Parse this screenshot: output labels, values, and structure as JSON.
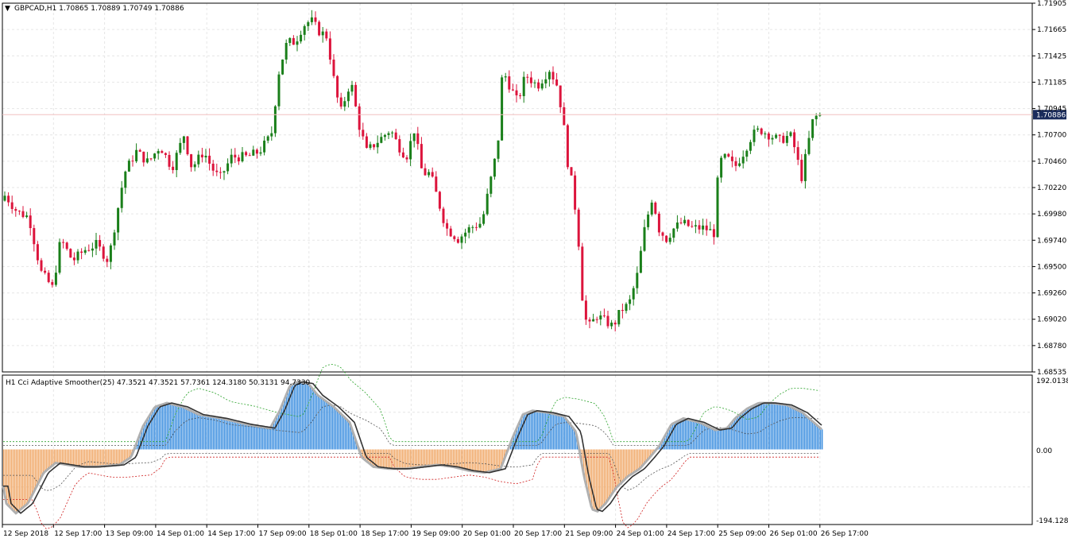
{
  "window": {
    "title": "GBPCAD,H1  1.70865 1.70889 1.70749 1.70886"
  },
  "indicator": {
    "title": "H1 Cci Adaptive Smoother(25) 47.3521 47.3521 57.7361 124.3180 50.3131 94.7330",
    "scale_labels": [
      "192.0138",
      "0.00",
      "-194.1283"
    ]
  },
  "price_axis": {
    "labels": [
      "1.71905",
      "1.71665",
      "1.71425",
      "1.71185",
      "1.70945",
      "1.70700",
      "1.70460",
      "1.70220",
      "1.69980",
      "1.69740",
      "1.69500",
      "1.69260",
      "1.69020",
      "1.68780",
      "1.68535"
    ],
    "current_price": "1.70886"
  },
  "time_axis": {
    "labels": [
      "12 Sep 2018",
      "12 Sep 17:00",
      "13 Sep 09:00",
      "14 Sep 01:00",
      "14 Sep 17:00",
      "17 Sep 09:00",
      "18 Sep 01:00",
      "18 Sep 17:00",
      "19 Sep 09:00",
      "20 Sep 01:00",
      "20 Sep 17:00",
      "21 Sep 09:00",
      "24 Sep 01:00",
      "24 Sep 17:00",
      "25 Sep 09:00",
      "26 Sep 01:00",
      "26 Sep 17:00"
    ]
  },
  "colors": {
    "bull": "#1a7f1a",
    "bear": "#dc143c",
    "hist_pos": "#3d8fe0",
    "hist_neg": "#f0a868",
    "line_main": "#333333",
    "line_shadow": "#b0b0b0",
    "grid": "#e6e6e6",
    "current_price_bg": "#1a2c5c"
  },
  "chart_data": {
    "type": "candlestick",
    "symbol": "GBPCAD",
    "timeframe": "H1",
    "ylim": [
      1.68535,
      1.71905
    ],
    "price_path": [
      [
        0,
        1.7005
      ],
      [
        10,
        1.7015
      ],
      [
        25,
        1.7
      ],
      [
        40,
        1.6995
      ],
      [
        55,
        1.6945
      ],
      [
        70,
        1.693
      ],
      [
        80,
        1.6975
      ],
      [
        95,
        1.6955
      ],
      [
        110,
        1.6965
      ],
      [
        125,
        1.697
      ],
      [
        140,
        1.6955
      ],
      [
        150,
        1.6995
      ],
      [
        160,
        1.7035
      ],
      [
        175,
        1.7055
      ],
      [
        190,
        1.7045
      ],
      [
        205,
        1.706
      ],
      [
        220,
        1.704
      ],
      [
        235,
        1.707
      ],
      [
        245,
        1.704
      ],
      [
        260,
        1.7055
      ],
      [
        270,
        1.704
      ],
      [
        280,
        1.703
      ],
      [
        295,
        1.705
      ],
      [
        315,
        1.705
      ],
      [
        330,
        1.7055
      ],
      [
        345,
        1.707
      ],
      [
        355,
        1.713
      ],
      [
        365,
        1.7155
      ],
      [
        375,
        1.7155
      ],
      [
        385,
        1.717
      ],
      [
        395,
        1.7175
      ],
      [
        405,
        1.7165
      ],
      [
        415,
        1.716
      ],
      [
        425,
        1.7115
      ],
      [
        432,
        1.709
      ],
      [
        445,
        1.712
      ],
      [
        455,
        1.708
      ],
      [
        465,
        1.7055
      ],
      [
        480,
        1.7065
      ],
      [
        495,
        1.7075
      ],
      [
        505,
        1.706
      ],
      [
        515,
        1.705
      ],
      [
        525,
        1.7075
      ],
      [
        535,
        1.7035
      ],
      [
        545,
        1.7035
      ],
      [
        555,
        1.701
      ],
      [
        565,
        1.6985
      ],
      [
        580,
        1.6975
      ],
      [
        595,
        1.6985
      ],
      [
        610,
        1.699
      ],
      [
        620,
        1.7025
      ],
      [
        630,
        1.706
      ],
      [
        636,
        1.713
      ],
      [
        645,
        1.7115
      ],
      [
        655,
        1.71
      ],
      [
        665,
        1.7125
      ],
      [
        680,
        1.7115
      ],
      [
        695,
        1.713
      ],
      [
        705,
        1.7115
      ],
      [
        712,
        1.7085
      ],
      [
        718,
        1.7045
      ],
      [
        725,
        1.702
      ],
      [
        732,
        1.697
      ],
      [
        738,
        1.6905
      ],
      [
        745,
        1.6895
      ],
      [
        755,
        1.6905
      ],
      [
        765,
        1.69
      ],
      [
        775,
        1.6895
      ],
      [
        785,
        1.691
      ],
      [
        795,
        1.6915
      ],
      [
        805,
        1.694
      ],
      [
        815,
        1.6985
      ],
      [
        825,
        1.7015
      ],
      [
        832,
        1.6985
      ],
      [
        842,
        1.6975
      ],
      [
        852,
        1.6985
      ],
      [
        862,
        1.699
      ],
      [
        875,
        1.6985
      ],
      [
        890,
        1.6985
      ],
      [
        903,
        1.698
      ],
      [
        908,
        1.7045
      ],
      [
        918,
        1.705
      ],
      [
        928,
        1.704
      ],
      [
        940,
        1.7055
      ],
      [
        950,
        1.707
      ],
      [
        960,
        1.7075
      ],
      [
        972,
        1.707
      ],
      [
        985,
        1.7065
      ],
      [
        998,
        1.707
      ],
      [
        1005,
        1.7055
      ],
      [
        1012,
        1.703
      ],
      [
        1020,
        1.706
      ],
      [
        1027,
        1.7085
      ],
      [
        1035,
        1.7089
      ]
    ],
    "last": {
      "open": 1.70865,
      "high": 1.70889,
      "low": 1.70749,
      "close": 1.70886
    },
    "indicator": {
      "name": "Cci Adaptive Smoother",
      "period": 25,
      "values": [
        47.3521,
        47.3521,
        57.7361,
        124.318,
        50.3131,
        94.733
      ],
      "ylim": [
        -194.1283,
        192.0138
      ],
      "cci_path": [
        [
          0,
          -50
        ],
        [
          8,
          -140
        ],
        [
          20,
          -165
        ],
        [
          35,
          -140
        ],
        [
          55,
          -60
        ],
        [
          70,
          -35
        ],
        [
          85,
          -40
        ],
        [
          100,
          -45
        ],
        [
          120,
          -45
        ],
        [
          150,
          -40
        ],
        [
          165,
          -20
        ],
        [
          180,
          60
        ],
        [
          195,
          110
        ],
        [
          210,
          120
        ],
        [
          230,
          110
        ],
        [
          250,
          90
        ],
        [
          280,
          80
        ],
        [
          310,
          65
        ],
        [
          340,
          55
        ],
        [
          352,
          100
        ],
        [
          365,
          165
        ],
        [
          375,
          175
        ],
        [
          388,
          170
        ],
        [
          400,
          140
        ],
        [
          420,
          110
        ],
        [
          440,
          70
        ],
        [
          455,
          -20
        ],
        [
          470,
          -45
        ],
        [
          490,
          -50
        ],
        [
          510,
          -50
        ],
        [
          530,
          -45
        ],
        [
          550,
          -40
        ],
        [
          570,
          -45
        ],
        [
          590,
          -55
        ],
        [
          610,
          -60
        ],
        [
          630,
          -50
        ],
        [
          645,
          30
        ],
        [
          658,
          90
        ],
        [
          670,
          100
        ],
        [
          690,
          95
        ],
        [
          710,
          85
        ],
        [
          725,
          45
        ],
        [
          735,
          -70
        ],
        [
          745,
          -155
        ],
        [
          752,
          -160
        ],
        [
          762,
          -140
        ],
        [
          775,
          -100
        ],
        [
          790,
          -70
        ],
        [
          805,
          -50
        ],
        [
          818,
          -20
        ],
        [
          830,
          10
        ],
        [
          845,
          65
        ],
        [
          860,
          80
        ],
        [
          880,
          70
        ],
        [
          900,
          50
        ],
        [
          915,
          55
        ],
        [
          925,
          80
        ],
        [
          940,
          105
        ],
        [
          955,
          120
        ],
        [
          970,
          120
        ],
        [
          990,
          115
        ],
        [
          1010,
          95
        ],
        [
          1035,
          50
        ]
      ]
    }
  }
}
